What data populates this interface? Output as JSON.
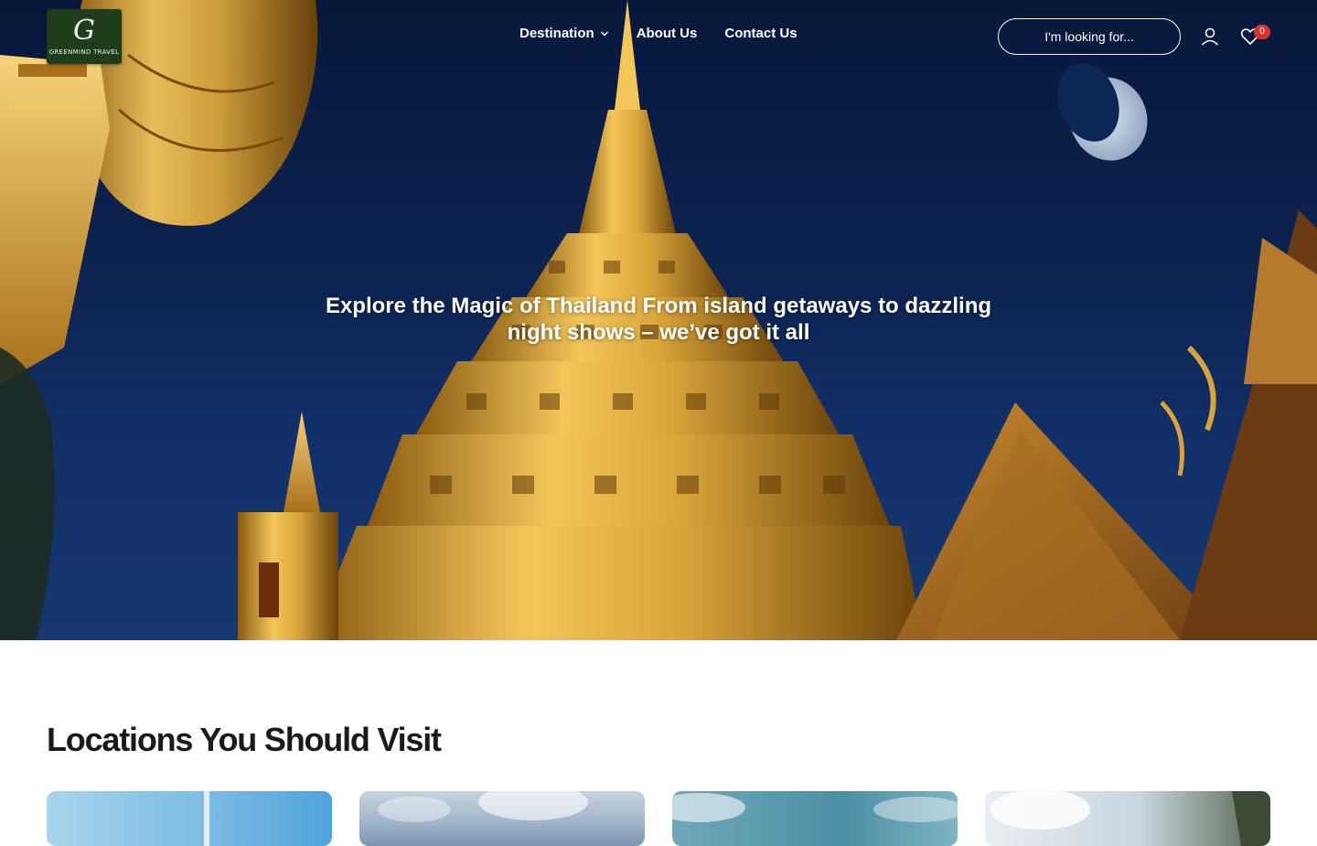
{
  "brand": {
    "logo_mark": "G",
    "logo_text": "GREENMIND TRAVEL"
  },
  "nav": {
    "items": [
      {
        "label": "Destination",
        "has_dropdown": true
      },
      {
        "label": "About Us",
        "has_dropdown": false
      },
      {
        "label": "Contact Us",
        "has_dropdown": false
      }
    ]
  },
  "search": {
    "placeholder": "I'm looking for..."
  },
  "header_icons": {
    "account": "user-icon",
    "wishlist": "heart-icon",
    "wishlist_count": "0"
  },
  "hero": {
    "headline": "Explore the Magic of Thailand From island getaways to dazzling night shows – we’ve got it all"
  },
  "locations": {
    "title": "Locations You Should Visit",
    "cards": [
      {
        "name": "location-card-1"
      },
      {
        "name": "location-card-2"
      },
      {
        "name": "location-card-3"
      },
      {
        "name": "location-card-4"
      }
    ]
  },
  "colors": {
    "sky": "#0d2452",
    "gold": "#d9a53a",
    "logo_bg": "#1f3d1b",
    "badge": "#d9342b"
  }
}
